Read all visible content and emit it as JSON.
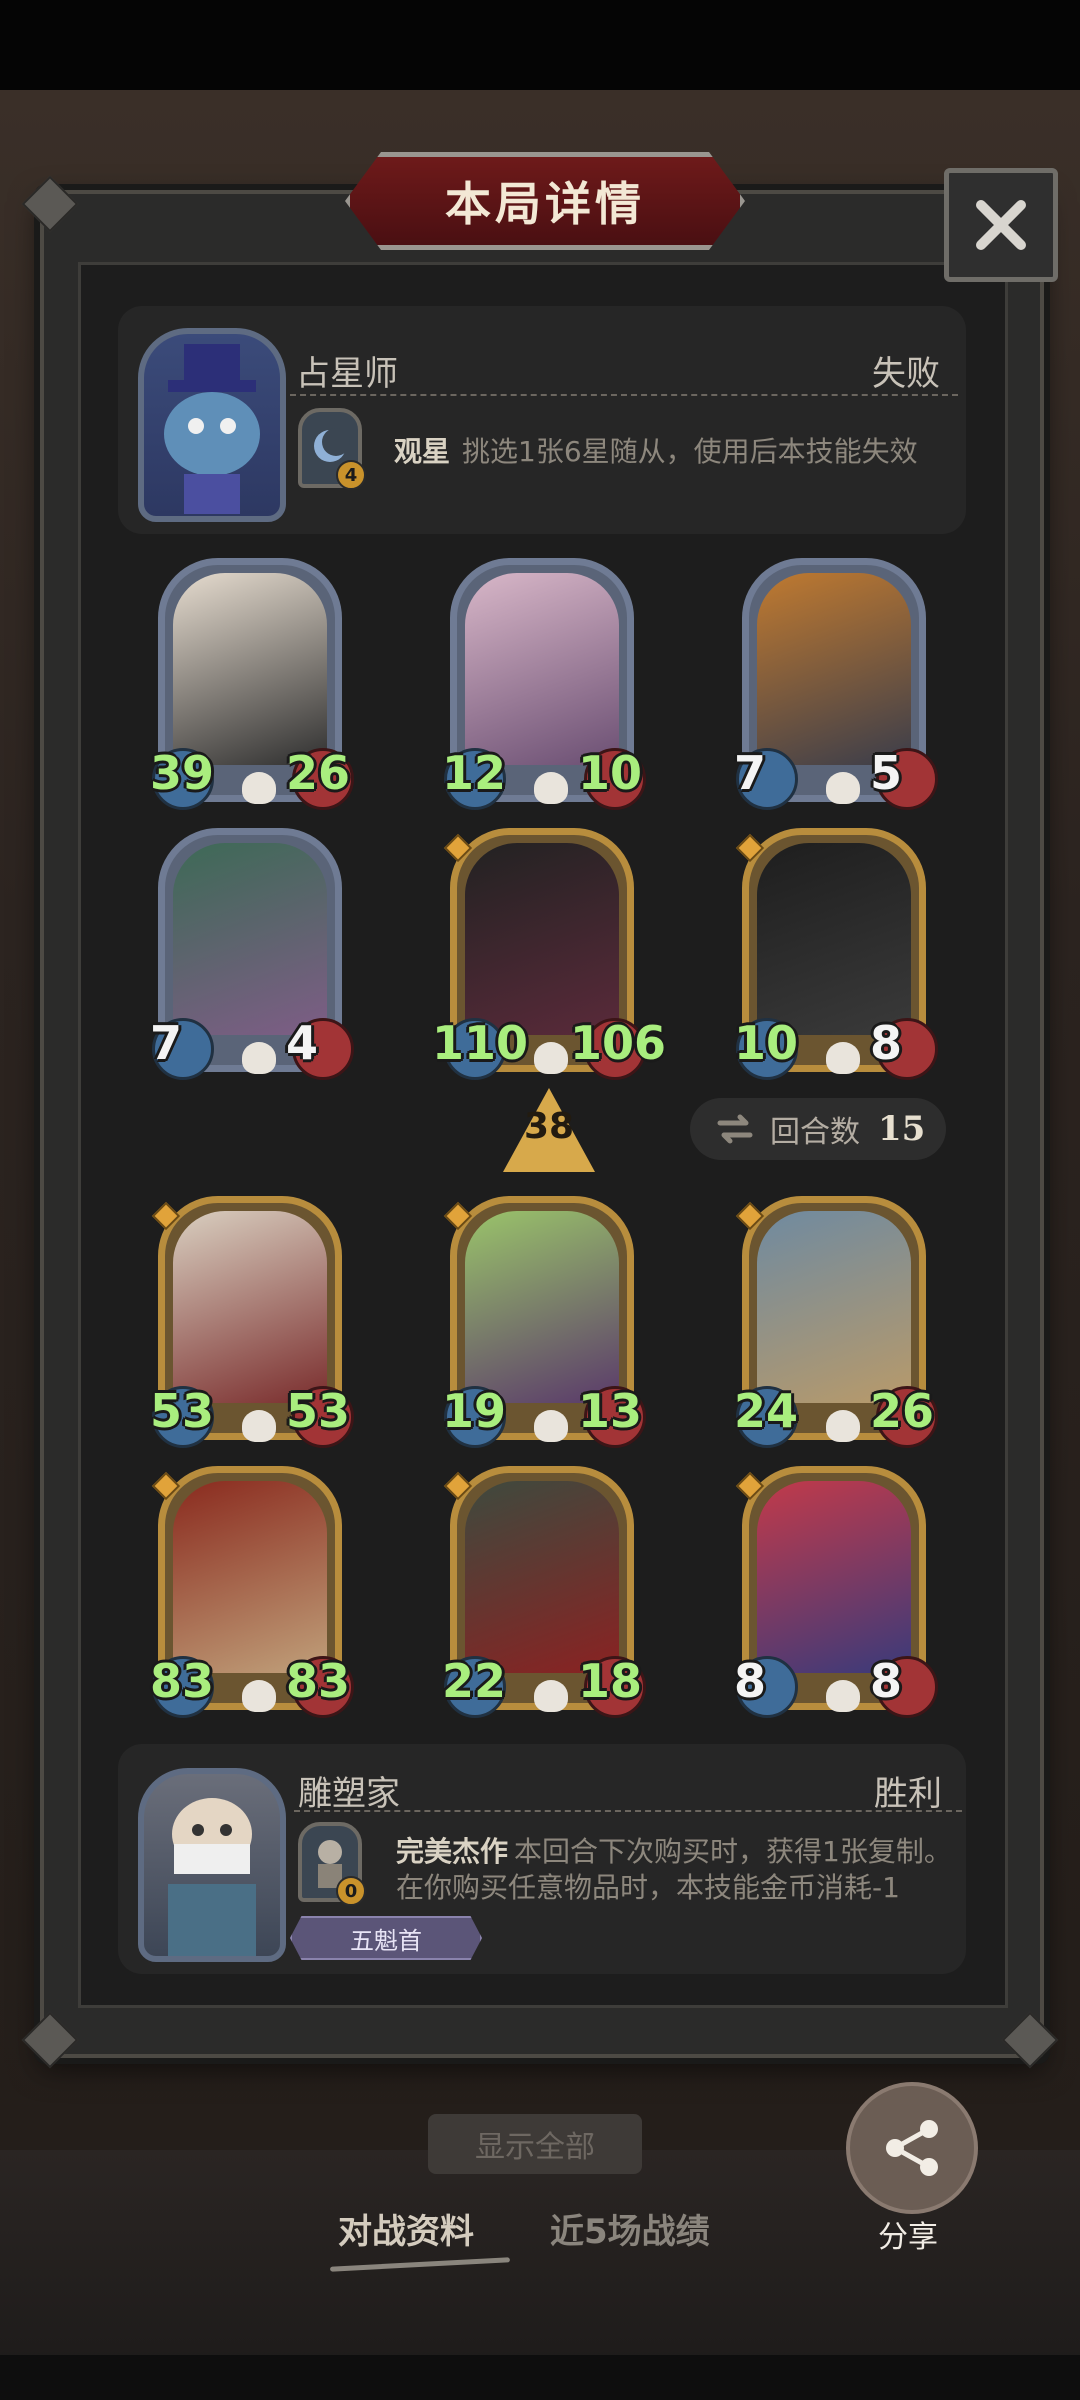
{
  "modal": {
    "title": "本局详情"
  },
  "opponent": {
    "name": "占星师",
    "result": "失败",
    "skill": {
      "level": "4",
      "name": "观星",
      "desc": "挑选1张6星随从，使用后本技能失效"
    },
    "units": [
      {
        "attack": "39",
        "health": "26",
        "tier": "silver",
        "art": [
          "#e6dccf",
          "#2f2f2f"
        ]
      },
      {
        "attack": "12",
        "health": "10",
        "tier": "silver",
        "art": [
          "#d8b7c8",
          "#6b4f73"
        ]
      },
      {
        "attack": "7",
        "health": "5",
        "tier": "silver",
        "art": [
          "#c07a30",
          "#3b3d4a"
        ]
      },
      {
        "attack": "7",
        "health": "4",
        "tier": "silver",
        "art": [
          "#3d6a56",
          "#7e5d86"
        ]
      },
      {
        "attack": "110",
        "health": "106",
        "tier": "gold",
        "art": [
          "#222",
          "#5a2a3a"
        ]
      },
      {
        "attack": "10",
        "health": "8",
        "tier": "gold",
        "art": [
          "#1e1e1e",
          "#3a3a3a"
        ]
      }
    ]
  },
  "middle": {
    "level": "38",
    "rounds_label": "回合数",
    "rounds_value": "15"
  },
  "player": {
    "name": "雕塑家",
    "result": "胜利",
    "skill": {
      "level": "0",
      "name": "完美杰作",
      "desc_line1": "本回合下次购买时，获得1张复制。",
      "desc_line2": "在你购买任意物品时，本技能金币消耗-1"
    },
    "title_badge": "五魁首",
    "units": [
      {
        "attack": "53",
        "health": "53",
        "tier": "gold",
        "art": [
          "#d9cfc0",
          "#7a2d2d"
        ]
      },
      {
        "attack": "19",
        "health": "13",
        "tier": "gold",
        "art": [
          "#9ac46a",
          "#5a3a6a"
        ]
      },
      {
        "attack": "24",
        "health": "26",
        "tier": "gold",
        "art": [
          "#6f8aa0",
          "#b89a6a"
        ]
      },
      {
        "attack": "83",
        "health": "83",
        "tier": "gold",
        "art": [
          "#8a2a1e",
          "#c0a07a"
        ]
      },
      {
        "attack": "22",
        "health": "18",
        "tier": "gold",
        "art": [
          "#3e4a3e",
          "#8a2222"
        ]
      },
      {
        "attack": "8",
        "health": "8",
        "tier": "gold",
        "art": [
          "#c23a4a",
          "#3a3a7a"
        ]
      }
    ]
  },
  "footer": {
    "hidden_button": "显示全部",
    "share_label": "分享",
    "tabs": [
      "对战资料",
      "近5场战绩"
    ]
  },
  "colors": {
    "stat_green": "#a9ee7e",
    "frame": "#2b2b2a",
    "title_red": "#6e1a1a",
    "gold": "#b88d3d"
  }
}
